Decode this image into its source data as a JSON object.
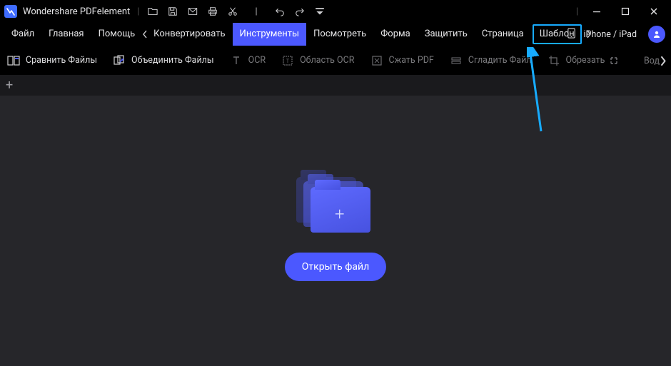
{
  "app": {
    "title": "Wondershare PDFelement"
  },
  "menu": {
    "file": "Файл",
    "home": "Главная",
    "help": "Помощь",
    "convert": "Конвертировать",
    "tools": "Инструменты",
    "view": "Посмотреть",
    "form": "Форма",
    "protect": "Защитить",
    "page": "Страница",
    "template": "Шаблон",
    "device": "iPhone / iPad"
  },
  "ribbon": {
    "compare": "Сравнить Файлы",
    "combine": "Объединить Файлы",
    "ocr": "OCR",
    "ocr_area": "Область OCR",
    "compress": "Сжать PDF",
    "flatten": "Сгладить Файл",
    "crop": "Обрезать",
    "watermark": "Вод"
  },
  "workspace": {
    "open_button": "Открыть файл"
  }
}
